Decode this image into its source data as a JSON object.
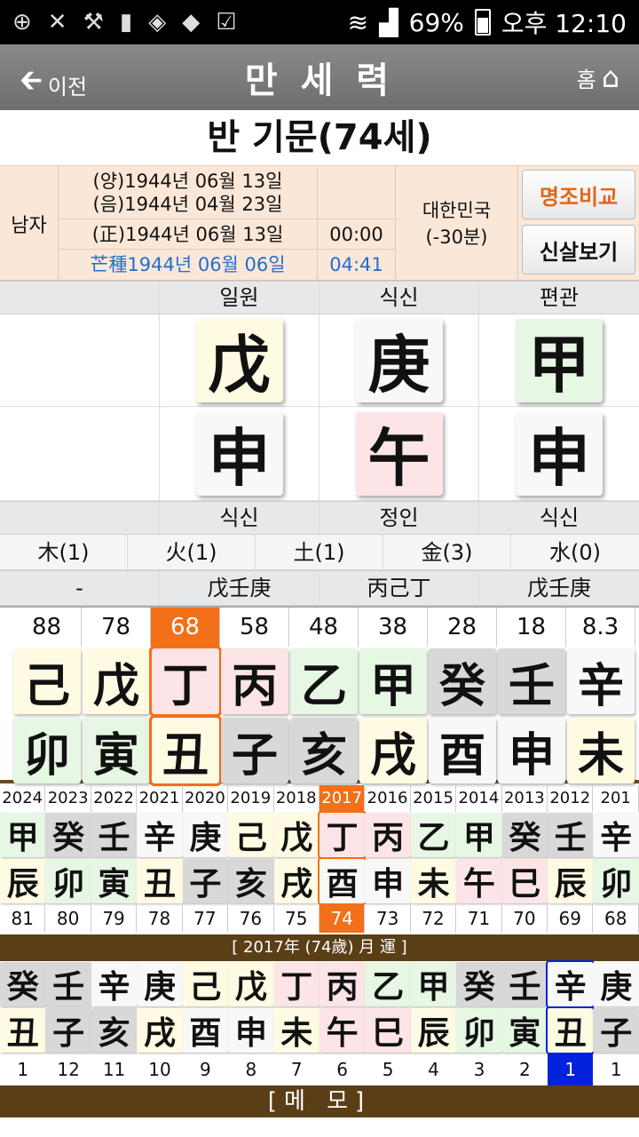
{
  "status": {
    "battery_pct": "69%",
    "time": "오후 12:10"
  },
  "titlebar": {
    "back": "이전",
    "title": "만 세 력",
    "home": "홈"
  },
  "person": {
    "name": "반 기문(74세)",
    "gender": "남자",
    "solar": "(양)1944년 06월 13일",
    "lunar": "(음)1944년 04월 23일",
    "corrected": "(正)1944년 06월 13일",
    "corrected_time": "00:00",
    "term": "芒種1944년 06월 06일",
    "term_time": "04:41",
    "country": "대한민국",
    "offset": "(-30분)"
  },
  "buttons": {
    "compare": "명조비교",
    "shinsal": "신살보기"
  },
  "top_labels": [
    "",
    "일원",
    "식신",
    "편관"
  ],
  "stems": [
    {
      "char": "戊",
      "color": "y"
    },
    {
      "char": "庚",
      "color": "w"
    },
    {
      "char": "甲",
      "color": "g"
    }
  ],
  "branches": [
    {
      "char": "申",
      "color": "w"
    },
    {
      "char": "午",
      "color": "p"
    },
    {
      "char": "申",
      "color": "w"
    }
  ],
  "bottom_labels": [
    "",
    "식신",
    "정인",
    "식신"
  ],
  "elements": [
    "木(1)",
    "火(1)",
    "土(1)",
    "金(3)",
    "水(0)"
  ],
  "hidden": [
    "-",
    "戊壬庚",
    "丙己丁",
    "戊壬庚"
  ],
  "daeun": {
    "ages": [
      "88",
      "78",
      "68",
      "58",
      "48",
      "38",
      "28",
      "18",
      "8.3"
    ],
    "selected": 2,
    "stems": [
      [
        "己",
        "y"
      ],
      [
        "戊",
        "y"
      ],
      [
        "丁",
        "p"
      ],
      [
        "丙",
        "p"
      ],
      [
        "乙",
        "g"
      ],
      [
        "甲",
        "g"
      ],
      [
        "癸",
        "gr"
      ],
      [
        "壬",
        "gr"
      ],
      [
        "辛",
        "w"
      ]
    ],
    "branches": [
      [
        "卯",
        "g"
      ],
      [
        "寅",
        "g"
      ],
      [
        "丑",
        "y"
      ],
      [
        "子",
        "gr"
      ],
      [
        "亥",
        "gr"
      ],
      [
        "戌",
        "y"
      ],
      [
        "酉",
        "w"
      ],
      [
        "申",
        "w"
      ],
      [
        "未",
        "y"
      ]
    ]
  },
  "seun": {
    "years": [
      "2024",
      "2023",
      "2022",
      "2021",
      "2020",
      "2019",
      "2018",
      "2017",
      "2016",
      "2015",
      "2014",
      "2013",
      "2012",
      "201"
    ],
    "selected": 7,
    "stems": [
      [
        "甲",
        "g"
      ],
      [
        "癸",
        "gr"
      ],
      [
        "壬",
        "gr"
      ],
      [
        "辛",
        "w"
      ],
      [
        "庚",
        "w"
      ],
      [
        "己",
        "y"
      ],
      [
        "戊",
        "y"
      ],
      [
        "丁",
        "p"
      ],
      [
        "丙",
        "p"
      ],
      [
        "乙",
        "g"
      ],
      [
        "甲",
        "g"
      ],
      [
        "癸",
        "gr"
      ],
      [
        "壬",
        "gr"
      ],
      [
        "辛",
        "w"
      ]
    ],
    "branches": [
      [
        "辰",
        "y"
      ],
      [
        "卯",
        "g"
      ],
      [
        "寅",
        "g"
      ],
      [
        "丑",
        "y"
      ],
      [
        "子",
        "gr"
      ],
      [
        "亥",
        "gr"
      ],
      [
        "戌",
        "y"
      ],
      [
        "酉",
        "w"
      ],
      [
        "申",
        "w"
      ],
      [
        "未",
        "y"
      ],
      [
        "午",
        "p"
      ],
      [
        "巳",
        "p"
      ],
      [
        "辰",
        "y"
      ],
      [
        "卯",
        "g"
      ]
    ],
    "ages": [
      "81",
      "80",
      "79",
      "78",
      "77",
      "76",
      "75",
      "74",
      "73",
      "72",
      "71",
      "70",
      "69",
      "68"
    ]
  },
  "wolun": {
    "title": "[ 2017年 (74歲) 月 運 ]",
    "selected": 12,
    "stems": [
      [
        "癸",
        "gr"
      ],
      [
        "壬",
        "gr"
      ],
      [
        "辛",
        "w"
      ],
      [
        "庚",
        "w"
      ],
      [
        "己",
        "y"
      ],
      [
        "戊",
        "y"
      ],
      [
        "丁",
        "p"
      ],
      [
        "丙",
        "p"
      ],
      [
        "乙",
        "g"
      ],
      [
        "甲",
        "g"
      ],
      [
        "癸",
        "gr"
      ],
      [
        "壬",
        "gr"
      ],
      [
        "辛",
        "w"
      ],
      [
        "庚",
        "w"
      ]
    ],
    "branches": [
      [
        "丑",
        "y"
      ],
      [
        "子",
        "gr"
      ],
      [
        "亥",
        "gr"
      ],
      [
        "戌",
        "y"
      ],
      [
        "酉",
        "w"
      ],
      [
        "申",
        "w"
      ],
      [
        "未",
        "y"
      ],
      [
        "午",
        "p"
      ],
      [
        "巳",
        "p"
      ],
      [
        "辰",
        "y"
      ],
      [
        "卯",
        "g"
      ],
      [
        "寅",
        "g"
      ],
      [
        "丑",
        "y"
      ],
      [
        "子",
        "gr"
      ]
    ],
    "months": [
      "1",
      "12",
      "11",
      "10",
      "9",
      "8",
      "7",
      "6",
      "5",
      "4",
      "3",
      "2",
      "1",
      "1"
    ]
  },
  "memo": "[메 모]"
}
